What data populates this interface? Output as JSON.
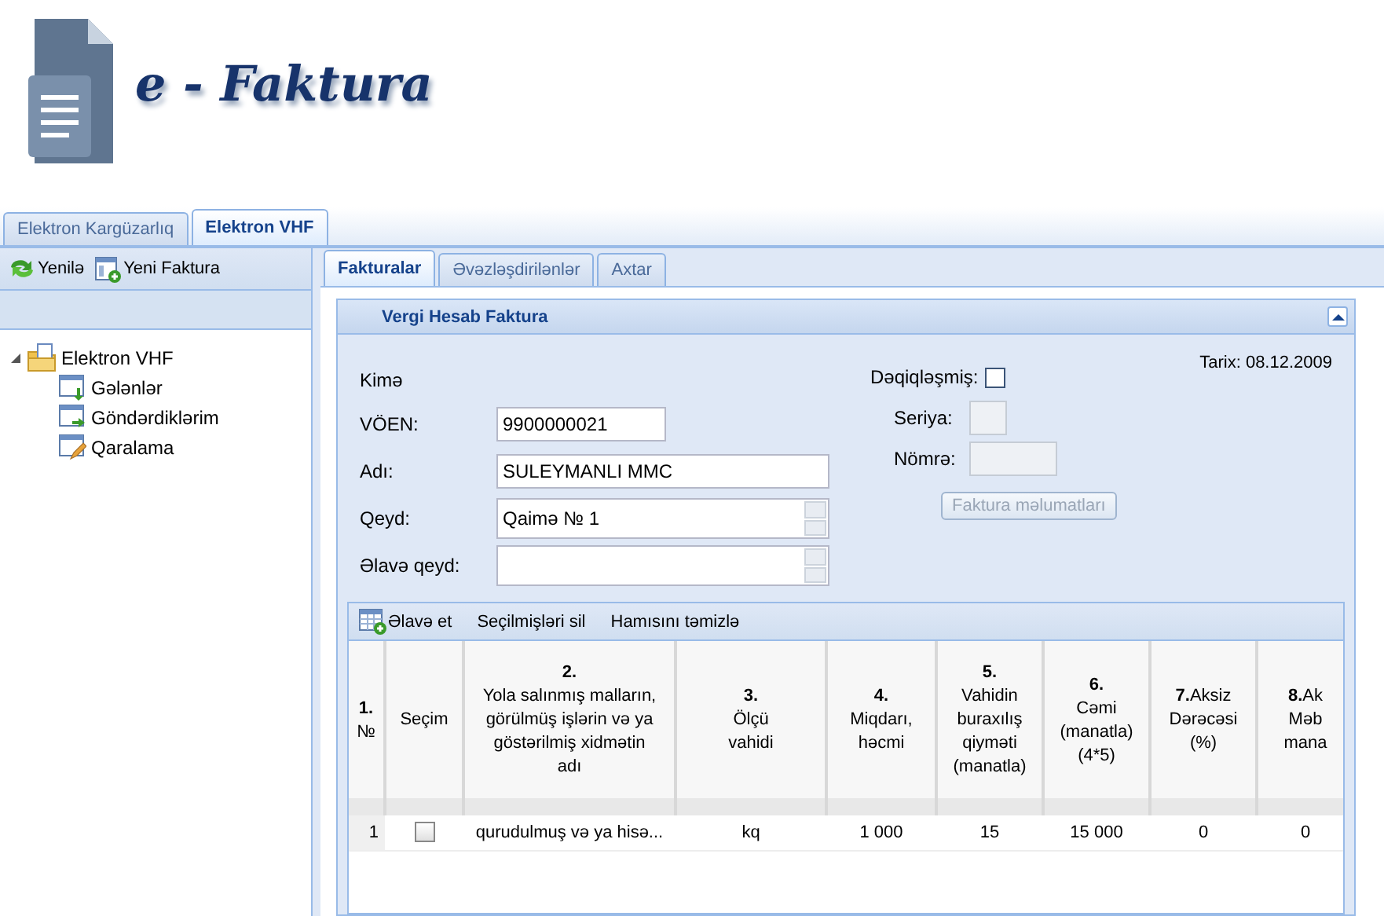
{
  "logo": {
    "title": "e - Faktura"
  },
  "main_tabs": [
    {
      "label": "Elektron Kargüzarlıq",
      "selected": false
    },
    {
      "label": "Elektron VHF",
      "selected": true
    }
  ],
  "sidebar": {
    "toolbar": [
      "Yenilə",
      "Yeni Faktura"
    ],
    "tree": [
      {
        "label": "Elektron VHF",
        "expanded": true,
        "children": [
          {
            "label": "Gələnlər",
            "kind": "incoming"
          },
          {
            "label": "Göndərdiklərim",
            "kind": "sent"
          },
          {
            "label": "Qaralama",
            "kind": "draft"
          }
        ]
      }
    ]
  },
  "sub_tabs": [
    {
      "label": "Fakturalar",
      "selected": true
    },
    {
      "label": "Əvəzləşdirilənlər",
      "selected": false
    },
    {
      "label": "Axtar",
      "selected": false
    }
  ],
  "panel": {
    "title": "Vergi Hesab Faktura",
    "recipient_label": "Kimə",
    "date": "Tarix: 08.12.2009",
    "fields": [
      {
        "label": "VÖEN:",
        "value": "9900000021",
        "kind": "short"
      },
      {
        "label": "Adı:",
        "value": "SULEYMANLI MMC",
        "kind": "wide"
      },
      {
        "label": "Qeyd:",
        "value": "Qaimə № 1",
        "kind": "spin"
      },
      {
        "label": "Əlavə qeyd:",
        "kind": "spin"
      }
    ],
    "corrected": {
      "label": "Dəqiqləşmiş:",
      "checked": false
    },
    "series": {
      "label": "Seriya:",
      "disabled": true
    },
    "number": {
      "label": "Nömrə:",
      "disabled": true
    },
    "info_button": {
      "label": "Faktura məlumatları",
      "disabled": true
    }
  },
  "grid": {
    "toolbar": [
      "Əlavə et",
      "Seçilmişləri sil",
      "Hamısını təmizlə"
    ],
    "columns": [
      {
        "heading": "**1.**\n№"
      },
      {
        "heading": "Seçim",
        "kind": "checkbox"
      },
      {
        "heading": "**2.**\nYola salınmış malların,\ngörülmüş işlərin və ya\ngöstərilmiş xidmətin\nadı"
      },
      {
        "heading": "**3.**\nÖlçü\nvahidi"
      },
      {
        "heading": "**4.**\nMiqdarı,\nhəcmi"
      },
      {
        "heading": "**5.**\nVahidin\nburaxılış\nqiyməti\n(manatla)"
      },
      {
        "heading": "**6.**\nCəmi\n(manatla)\n(4*5)"
      },
      {
        "heading": "**7.**Aksiz\nDərəcəsi\n(%)"
      },
      {
        "heading": "**8.**Ak\nMəb\nmana"
      }
    ],
    "rows": [
      {
        "checked": false,
        "cells": [
          "1",
          "",
          "qurudulmuş və ya hisə...",
          "kq",
          "1 000",
          "15",
          "15 000",
          "0",
          "0"
        ]
      }
    ]
  }
}
